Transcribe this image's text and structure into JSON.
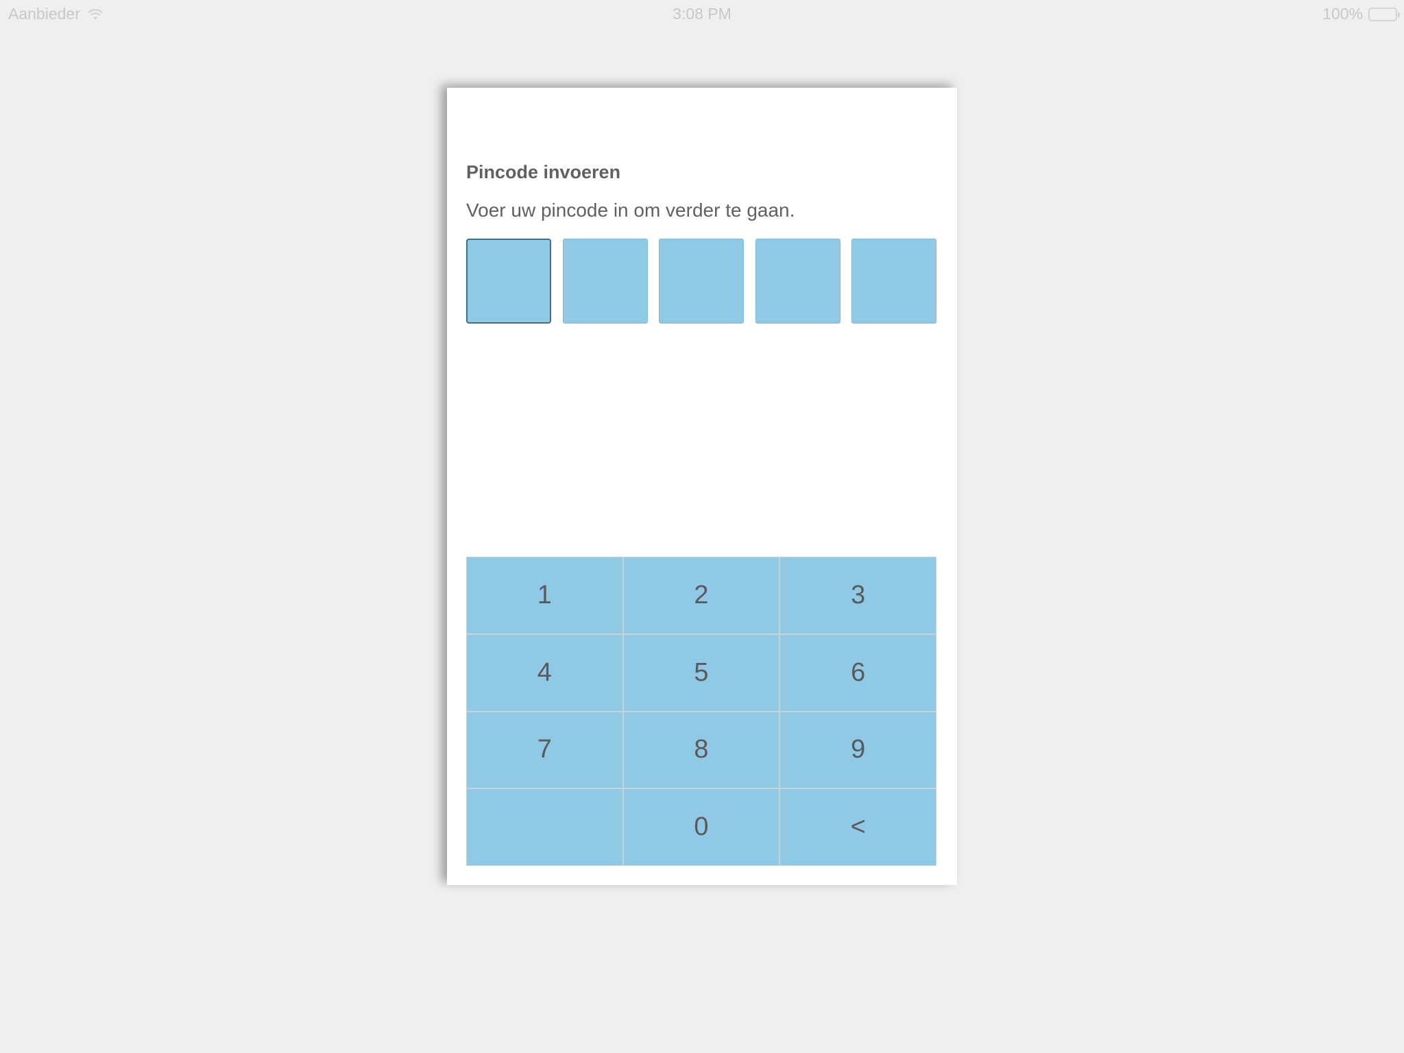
{
  "status_bar": {
    "carrier": "Aanbieder",
    "time": "3:08 PM",
    "battery": "100%"
  },
  "pin_screen": {
    "title": "Pincode invoeren",
    "instruction": "Voer uw pincode in om verder te gaan.",
    "pin_length": 5,
    "active_index": 0
  },
  "keypad": {
    "keys": [
      "1",
      "2",
      "3",
      "4",
      "5",
      "6",
      "7",
      "8",
      "9",
      "",
      "0",
      "<"
    ]
  },
  "colors": {
    "background": "#efefef",
    "card": "#ffffff",
    "key_fill": "#90c9e6",
    "text": "#606060",
    "active_border": "#3e6f87"
  }
}
